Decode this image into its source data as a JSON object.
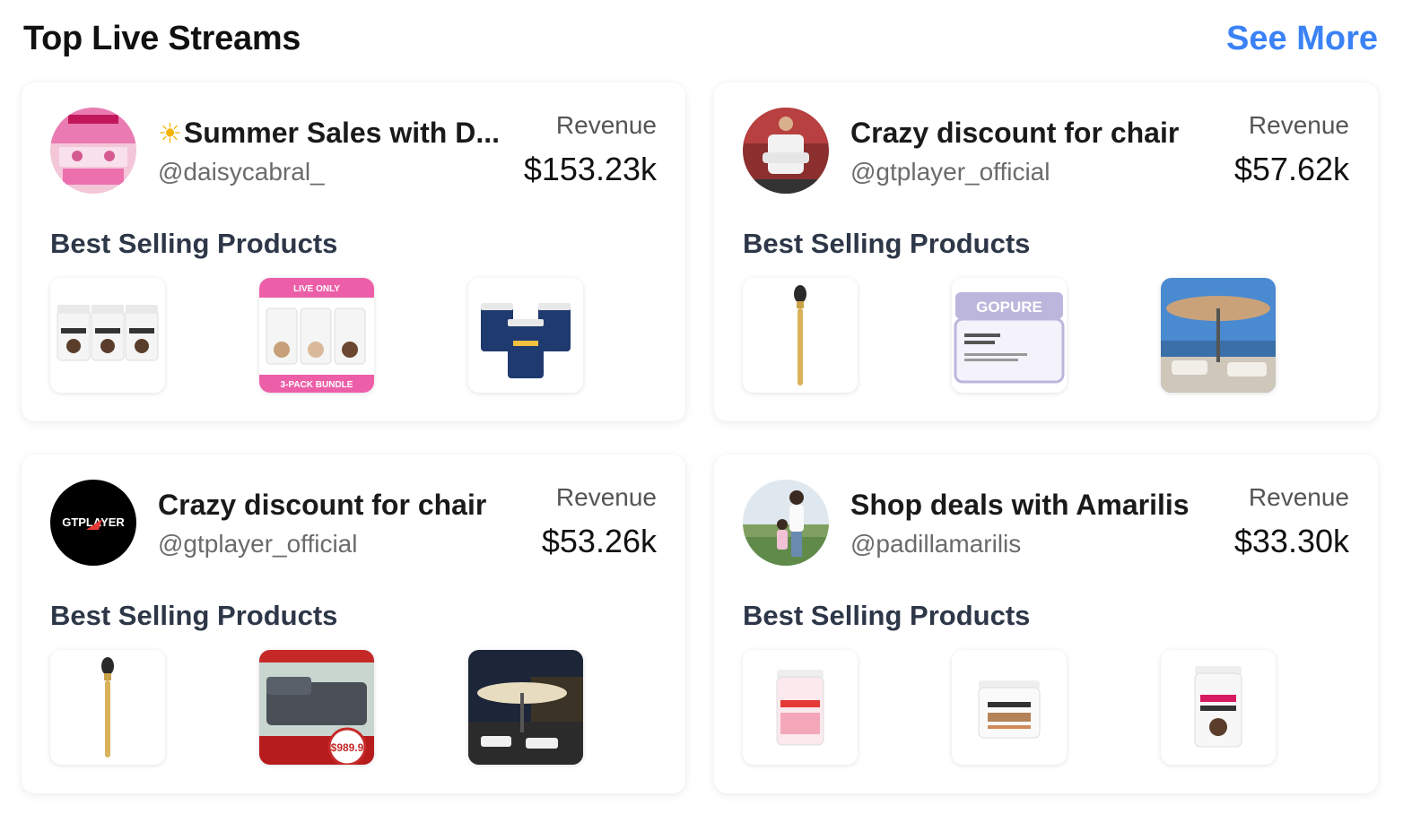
{
  "header": {
    "title": "Top Live Streams",
    "see_more": "See More"
  },
  "streams": [
    {
      "title": "Summer Sales with D...",
      "title_icon": "sun-icon",
      "handle": "@daisycabral_",
      "revenue_label": "Revenue",
      "revenue": "$153.23k",
      "best_selling_label": "Best Selling Products",
      "products": [
        {
          "name": "iced-coffee-3-jars"
        },
        {
          "name": "live-only-3-pack-bundle",
          "badge_top": "LIVE ONLY",
          "badge_bottom": "3-PACK BUNDLE"
        },
        {
          "name": "detox-3-jars"
        }
      ]
    },
    {
      "title": "Crazy discount for chair",
      "handle": "@gtplayer_official",
      "revenue_label": "Revenue",
      "revenue": "$57.62k",
      "best_selling_label": "Best Selling Products",
      "products": [
        {
          "name": "makeup-brush"
        },
        {
          "name": "gopure-neck-cream",
          "brand": "GOPURE"
        },
        {
          "name": "patio-umbrella"
        }
      ]
    },
    {
      "title": "Crazy discount for chair",
      "handle": "@gtplayer_official",
      "avatar_text": "GTPLAYER",
      "revenue_label": "Revenue",
      "revenue": "$53.26k",
      "best_selling_label": "Best Selling Products",
      "products": [
        {
          "name": "makeup-brush"
        },
        {
          "name": "sectional-sofa-promo",
          "price": "$989.9"
        },
        {
          "name": "patio-umbrella-night"
        }
      ]
    },
    {
      "title": "Shop deals with Amarilis",
      "handle": "@padillamarilis",
      "revenue_label": "Revenue",
      "revenue": "$33.30k",
      "best_selling_label": "Best Selling Products",
      "products": [
        {
          "name": "iced-strawberry-jar"
        },
        {
          "name": "bella-jar"
        },
        {
          "name": "iced-coffee-jar"
        }
      ]
    }
  ]
}
